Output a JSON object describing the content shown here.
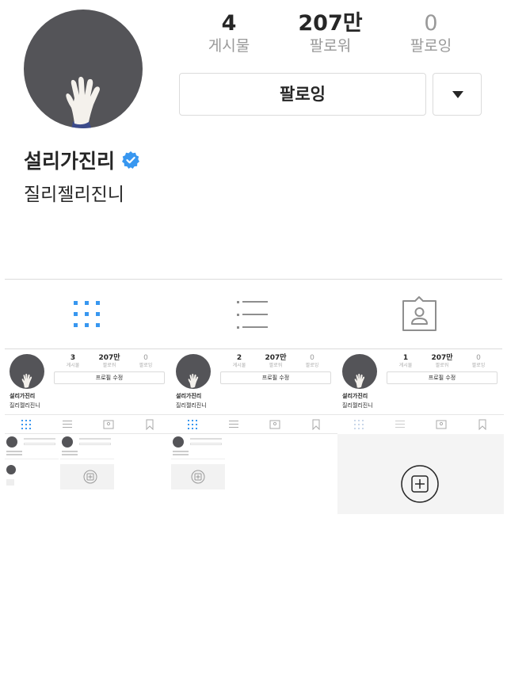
{
  "profile": {
    "username": "설리가진리",
    "bio": "질리젤리진니",
    "stats": [
      {
        "value": "4",
        "label": "게시물"
      },
      {
        "value": "207만",
        "label": "팔로워"
      },
      {
        "value": "0",
        "label": "팔로잉"
      }
    ],
    "follow_label": "팔로잉"
  },
  "tabs": [
    {
      "name": "grid",
      "active": true
    },
    {
      "name": "list",
      "active": false
    },
    {
      "name": "tagged",
      "active": false
    }
  ],
  "thumbnails": [
    {
      "username": "설리가진리",
      "bio": "질리젤리진니",
      "edit_label": "프로필 수정",
      "stats": [
        {
          "value": "3",
          "label": "게시물"
        },
        {
          "value": "207만",
          "label": "팔로워"
        },
        {
          "value": "0",
          "label": "팔로잉"
        }
      ]
    },
    {
      "username": "설리가진리",
      "bio": "질리젤리진니",
      "edit_label": "프로필 수정",
      "stats": [
        {
          "value": "2",
          "label": "게시물"
        },
        {
          "value": "207만",
          "label": "팔로워"
        },
        {
          "value": "0",
          "label": "팔로잉"
        }
      ]
    },
    {
      "username": "설리가진리",
      "bio": "질리젤리진니",
      "edit_label": "프로필 수정",
      "stats": [
        {
          "value": "1",
          "label": "게시물"
        },
        {
          "value": "207만",
          "label": "팔로워"
        },
        {
          "value": "0",
          "label": "팔로잉"
        }
      ]
    }
  ],
  "colors": {
    "accent": "#3897f0",
    "text": "#262626",
    "muted": "#999999",
    "border": "#dbdbdb",
    "avatar_bg": "#545458"
  }
}
